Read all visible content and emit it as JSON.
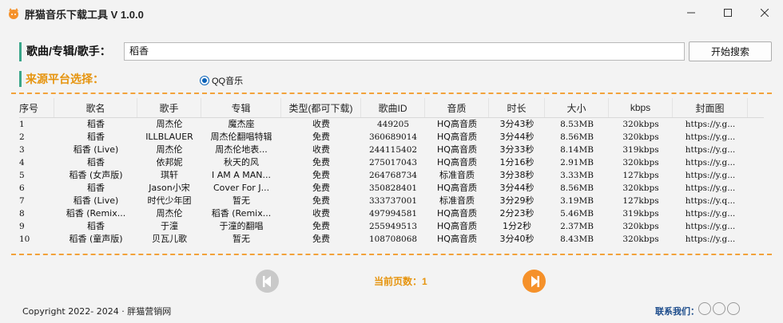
{
  "window": {
    "title": "胖猫音乐下载工具 V 1.0.0",
    "controls": [
      "minimize-icon",
      "maximize-icon",
      "close-icon"
    ]
  },
  "search": {
    "label": "歌曲/专辑/歌手：",
    "value": "稻香",
    "button_label": "开始搜索"
  },
  "source": {
    "label": "来源平台选择：",
    "options": [
      {
        "label": "QQ音乐",
        "selected": true
      }
    ]
  },
  "table": {
    "headers": [
      "序号",
      "歌名",
      "歌手",
      "专辑",
      "类型(都可下载)",
      "歌曲ID",
      "音质",
      "时长",
      "大小",
      "kbps",
      "封面图"
    ],
    "rows": [
      [
        "1",
        "稻香",
        "周杰伦",
        "魔杰座",
        "收费",
        "449205",
        "HQ高音质",
        "3分43秒",
        "8.53MB",
        "320kbps",
        "https://y.g..."
      ],
      [
        "2",
        "稻香",
        "ILLBLAUER",
        "周杰伦翻唱特辑",
        "免费",
        "360689014",
        "HQ高音质",
        "3分44秒",
        "8.56MB",
        "320kbps",
        "https://y.g..."
      ],
      [
        "3",
        "稻香 (Live)",
        "周杰伦",
        "周杰伦地表...",
        "收费",
        "244115402",
        "HQ高音质",
        "3分33秒",
        "8.14MB",
        "319kbps",
        "https://y.g..."
      ],
      [
        "4",
        "稻香",
        "依邦妮",
        "秋天的风",
        "免费",
        "275017043",
        "HQ高音质",
        "1分16秒",
        "2.91MB",
        "320kbps",
        "https://y.g..."
      ],
      [
        "5",
        "稻香 (女声版)",
        "琪轩",
        "I AM A MAN...",
        "免费",
        "264768734",
        "标准音质",
        "3分38秒",
        "3.33MB",
        "127kbps",
        "https://y.g..."
      ],
      [
        "6",
        "稻香",
        "Jason小宋",
        "Cover For J...",
        "免费",
        "350828401",
        "HQ高音质",
        "3分44秒",
        "8.56MB",
        "320kbps",
        "https://y.g..."
      ],
      [
        "7",
        "稻香 (Live)",
        "时代少年团",
        "暂无",
        "免费",
        "333737001",
        "标准音质",
        "3分29秒",
        "3.19MB",
        "127kbps",
        "https://y.q..."
      ],
      [
        "8",
        "稻香 (Remix...",
        "周杰伦",
        "稻香 (Remix...",
        "收费",
        "497994581",
        "HQ高音质",
        "2分23秒",
        "5.46MB",
        "319kbps",
        "https://y.g..."
      ],
      [
        "9",
        "稻香",
        "于潼",
        "于潼的翻唱",
        "免费",
        "255949513",
        "HQ高音质",
        "1分2秒",
        "2.37MB",
        "320kbps",
        "https://y.g..."
      ],
      [
        "10",
        "稻香 (童声版)",
        "贝瓦儿歌",
        "暂无",
        "免费",
        "108708068",
        "HQ高音质",
        "3分40秒",
        "8.43MB",
        "320kbps",
        "https://y.g..."
      ]
    ]
  },
  "pagination": {
    "label": "当前页数：1",
    "prev_icon": "prev-page-icon",
    "next_icon": "next-page-icon"
  },
  "footer": {
    "copyright": "Copyright 2022- 2024 · 胖猫营销网",
    "contact_label": "联系我们："
  },
  "colors": {
    "accent_orange": "#f5912a",
    "label_orange": "#e6940e",
    "label_bar_green": "#3aa68a",
    "radio_blue": "#0b63b8"
  }
}
